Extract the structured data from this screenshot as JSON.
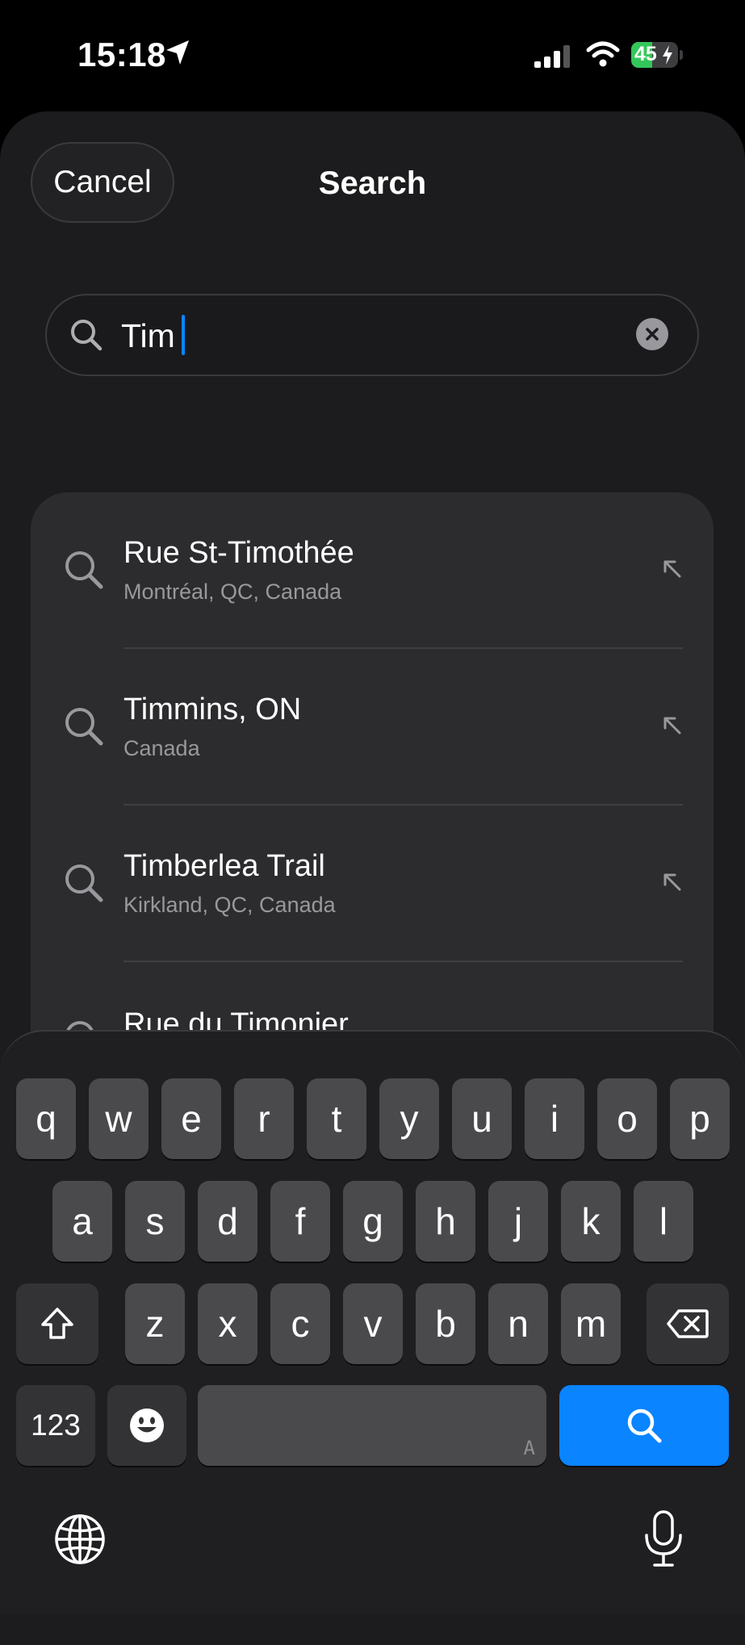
{
  "status_bar": {
    "time": "15:18",
    "battery": "45",
    "battery_level": 0.45,
    "icons": [
      "location-arrow-icon",
      "signal-icon",
      "wifi-icon",
      "battery-icon"
    ]
  },
  "sheet": {
    "cancel_label": "Cancel",
    "title": "Search"
  },
  "search": {
    "value": "Tim",
    "icon": "search-icon",
    "clear_icon": "clear-icon"
  },
  "results": [
    {
      "title": "Rue St-Timothée",
      "subtitle": "Montréal, QC, Canada"
    },
    {
      "title": "Timmins, ON",
      "subtitle": "Canada"
    },
    {
      "title": "Timberlea Trail",
      "subtitle": "Kirkland, QC, Canada"
    },
    {
      "title": "Rue du Timonier",
      "subtitle": ""
    }
  ],
  "keyboard": {
    "row1": [
      "q",
      "w",
      "e",
      "r",
      "t",
      "y",
      "u",
      "i",
      "o",
      "p"
    ],
    "row2": [
      "a",
      "s",
      "d",
      "f",
      "g",
      "h",
      "j",
      "k",
      "l"
    ],
    "row3": [
      "z",
      "x",
      "c",
      "v",
      "b",
      "n",
      "m"
    ],
    "numbers_label": "123",
    "space_hint": "A",
    "accent_color": "#0a84ff",
    "icons": [
      "shift-icon",
      "delete-icon",
      "emoji-icon",
      "search-icon",
      "globe-icon",
      "microphone-icon"
    ]
  }
}
